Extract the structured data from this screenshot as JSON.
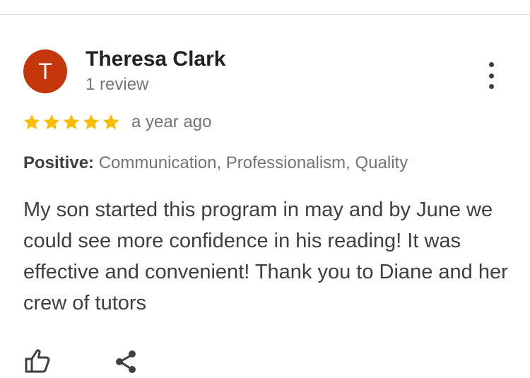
{
  "review": {
    "avatar_letter": "T",
    "avatar_color": "#c4360c",
    "reviewer_name": "Theresa Clark",
    "review_count": "1 review",
    "rating": 5,
    "rating_max": 5,
    "star_color": "#fbbc04",
    "date": "a year ago",
    "positive_label": "Positive:",
    "positive_items": "Communication, Professionalism, Quality",
    "text": "My son started this program in may and by June we could see more confidence in his reading! It was effective and convenient! Thank you to Diane and her crew of tutors"
  },
  "icons": {
    "more": "more-vert-icon",
    "star": "star-icon",
    "like": "thumb-up-icon",
    "share": "share-icon"
  }
}
